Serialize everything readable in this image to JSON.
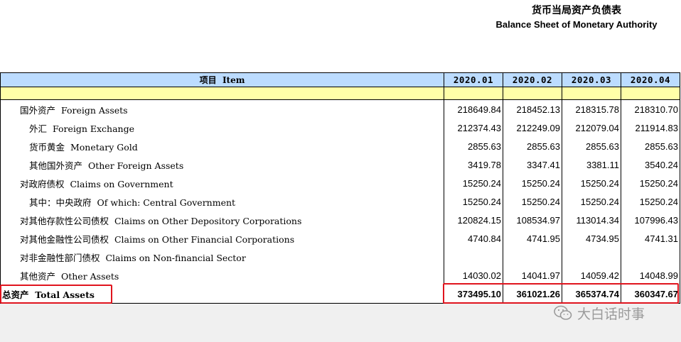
{
  "title": {
    "zh": "货币当局资产负债表",
    "en": "Balance Sheet of  Monetary Authority"
  },
  "table": {
    "header": {
      "item_zh": "项目",
      "item_en": "Item",
      "periods": [
        "2020.01",
        "2020.02",
        "2020.03",
        "2020.04"
      ]
    },
    "rows": [
      {
        "level": 1,
        "zh": "国外资产",
        "en": "Foreign Assets",
        "values": [
          "218649.84",
          "218452.13",
          "218315.78",
          "218310.70"
        ]
      },
      {
        "level": 2,
        "zh": "外汇",
        "en": "Foreign Exchange",
        "values": [
          "212374.43",
          "212249.09",
          "212079.04",
          "211914.83"
        ]
      },
      {
        "level": 2,
        "zh": "货币黄金",
        "en": "Monetary Gold",
        "values": [
          "2855.63",
          "2855.63",
          "2855.63",
          "2855.63"
        ]
      },
      {
        "level": 2,
        "zh": "其他国外资产",
        "en": "Other Foreign Assets",
        "values": [
          "3419.78",
          "3347.41",
          "3381.11",
          "3540.24"
        ]
      },
      {
        "level": 1,
        "zh": "对政府债权",
        "en": "Claims on Government",
        "values": [
          "15250.24",
          "15250.24",
          "15250.24",
          "15250.24"
        ]
      },
      {
        "level": 2,
        "zh": "其中：中央政府",
        "en": "Of which: Central Government",
        "values": [
          "15250.24",
          "15250.24",
          "15250.24",
          "15250.24"
        ]
      },
      {
        "level": 1,
        "zh": "对其他存款性公司债权",
        "en": "Claims on Other Depository Corporations",
        "values": [
          "120824.15",
          "108534.97",
          "113014.34",
          "107996.43"
        ]
      },
      {
        "level": 1,
        "zh": "对其他金融性公司债权",
        "en": "Claims on Other Financial Corporations",
        "values": [
          "4740.84",
          "4741.95",
          "4734.95",
          "4741.31"
        ]
      },
      {
        "level": 1,
        "zh": "对非金融性部门债权",
        "en": "Claims on Non-financial Sector",
        "values": [
          "",
          "",
          "",
          ""
        ]
      },
      {
        "level": 1,
        "zh": "其他资产",
        "en": "Other Assets",
        "values": [
          "14030.02",
          "14041.97",
          "14059.42",
          "14048.99"
        ]
      }
    ],
    "total": {
      "level": 0,
      "zh": "总资产",
      "en": "Total Assets",
      "values": [
        "373495.10",
        "361021.26",
        "365374.74",
        "360347.67"
      ]
    }
  },
  "watermark": {
    "text": "大白话时事",
    "icon": "wechat-icon"
  },
  "colors": {
    "header_bg": "#bcdcff",
    "band_bg": "#ffffa8",
    "highlight": "#e0141e"
  }
}
